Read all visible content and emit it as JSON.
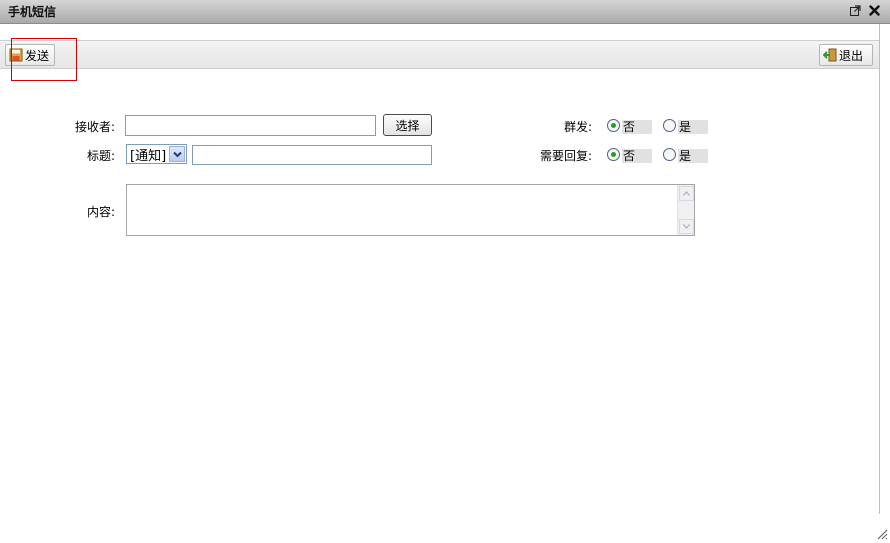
{
  "window": {
    "title": "手机短信"
  },
  "icons": {
    "popout": "external-window-icon",
    "close": "close-icon",
    "send": "save-disk-icon",
    "exit": "exit-door-icon",
    "dropdown": "chevron-down-icon",
    "scroll_up": "scroll-up-arrow-icon",
    "scroll_down": "scroll-down-arrow-icon",
    "resize": "resize-grip-icon"
  },
  "toolbar": {
    "send_label": "发送",
    "exit_label": "退出"
  },
  "form": {
    "receiver": {
      "label": "接收者:",
      "value": "",
      "select_button": "选择"
    },
    "subject": {
      "label": "标题:",
      "category": "[通知]",
      "value": ""
    },
    "content": {
      "label": "内容:",
      "value": ""
    },
    "group_send": {
      "label": "群发:",
      "options": [
        {
          "label": "否",
          "checked": true
        },
        {
          "label": "是",
          "checked": false
        }
      ]
    },
    "need_reply": {
      "label": "需要回复:",
      "options": [
        {
          "label": "否",
          "checked": true
        },
        {
          "label": "是",
          "checked": false
        }
      ]
    }
  },
  "colors": {
    "highlight_frame": "#d40000",
    "radio_checked": "#22a022"
  }
}
